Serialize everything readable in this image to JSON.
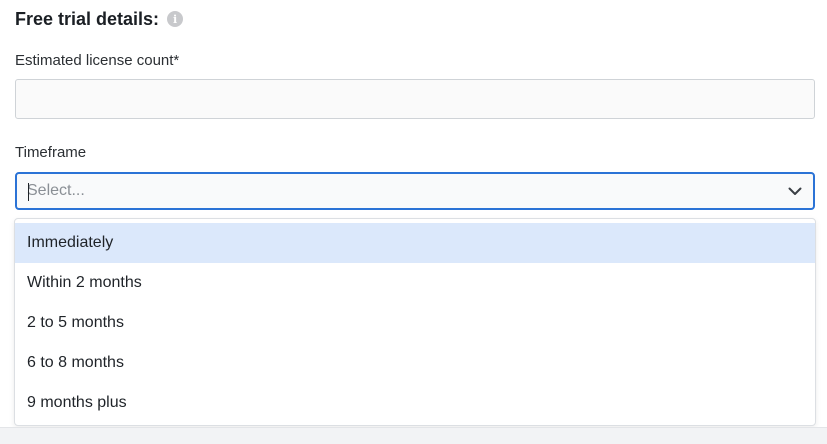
{
  "section": {
    "title": "Free trial details:",
    "info_icon_glyph": "i"
  },
  "license": {
    "label": "Estimated license count*",
    "value": "",
    "placeholder": ""
  },
  "timeframe": {
    "label": "Timeframe",
    "placeholder": "Select...",
    "options": [
      {
        "label": "Immediately",
        "highlighted": true
      },
      {
        "label": "Within 2 months",
        "highlighted": false
      },
      {
        "label": "2 to 5 months",
        "highlighted": false
      },
      {
        "label": "6 to 8 months",
        "highlighted": false
      },
      {
        "label": "9 months plus",
        "highlighted": false
      }
    ]
  },
  "colors": {
    "focus_border": "#2b73d6",
    "option_highlight": "#dbe8fb",
    "info_icon": "#c8c9cc"
  },
  "icons": {
    "info": "info-icon",
    "dropdown": "chevron-down-icon"
  }
}
